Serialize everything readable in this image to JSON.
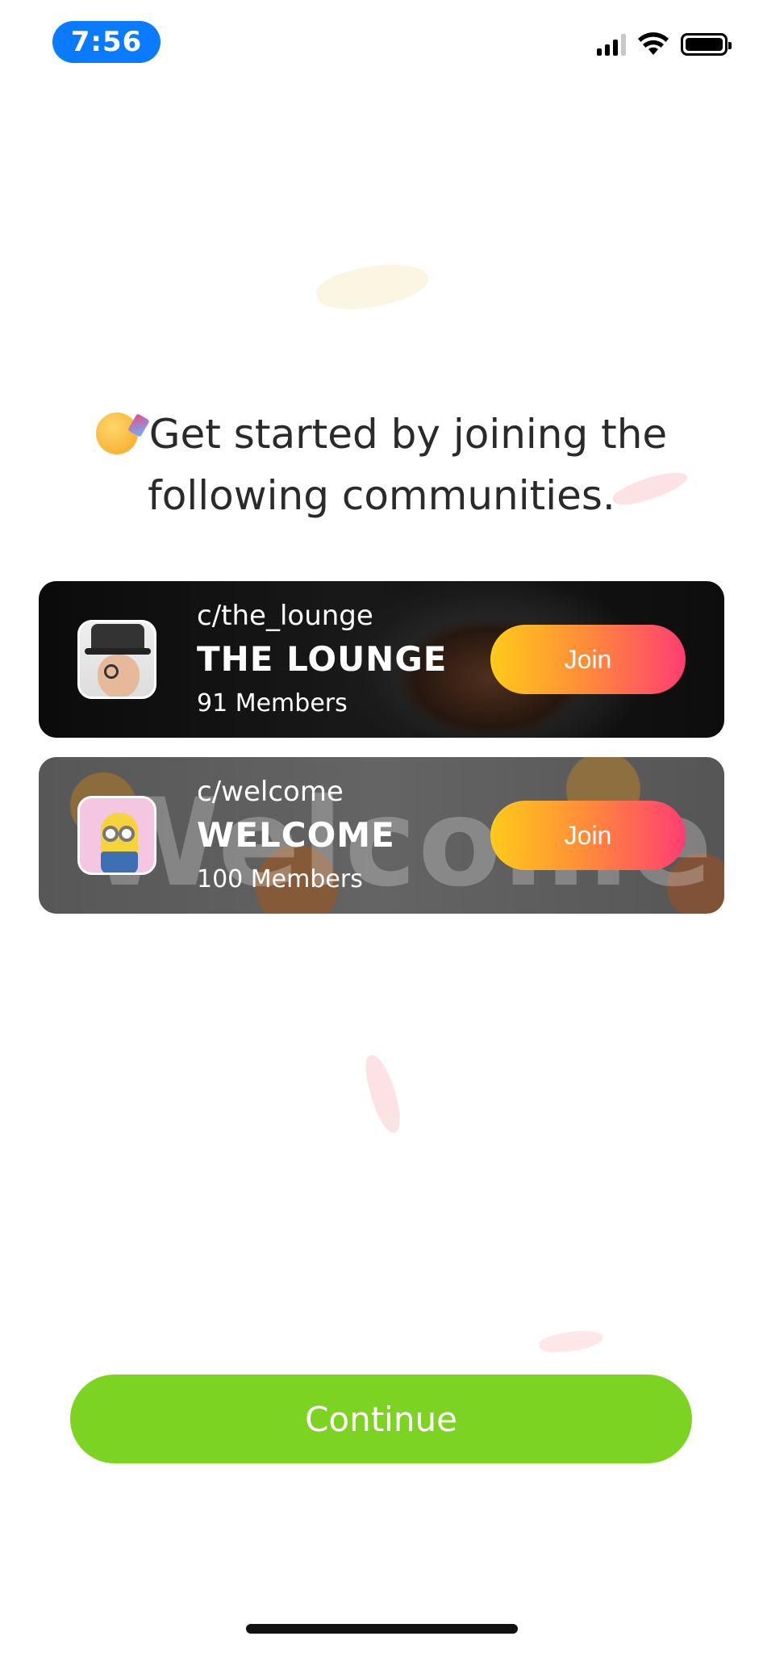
{
  "status_bar": {
    "time": "7:56",
    "icons": [
      "cellular-signal-icon",
      "wifi-icon",
      "battery-icon"
    ],
    "accent": "#0a7aff"
  },
  "heading": {
    "emoji": "partying-face-icon",
    "text": "Get started by joining the following communities."
  },
  "communities": [
    {
      "slug": "c/the_lounge",
      "name": "THE LOUNGE",
      "members": "91 Members",
      "join_label": "Join",
      "avatar": "gentleman-monocle-avatar"
    },
    {
      "slug": "c/welcome",
      "name": "WELCOME",
      "members": "100 Members",
      "join_label": "Join",
      "avatar": "minion-avatar",
      "background_word": "Welcome"
    }
  ],
  "continue_label": "Continue",
  "colors": {
    "continue": "#7dd321",
    "join_gradient_start": "#ffca1a",
    "join_gradient_end": "#ff3d71"
  }
}
